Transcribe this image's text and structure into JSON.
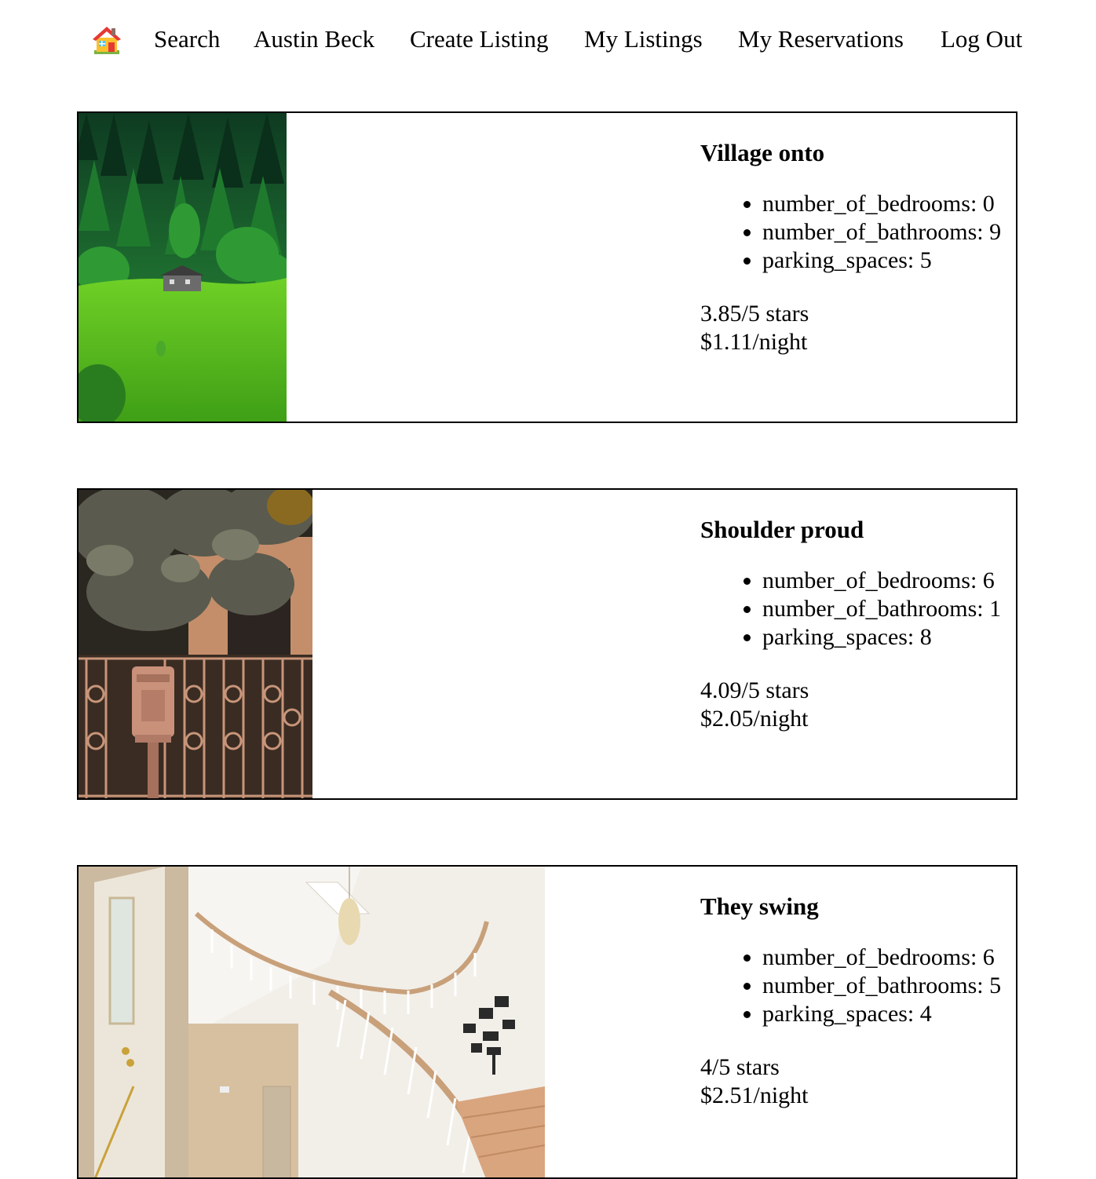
{
  "nav": {
    "home_icon": "house-icon",
    "items": [
      {
        "label": "Search"
      },
      {
        "label": "Austin Beck"
      },
      {
        "label": "Create Listing"
      },
      {
        "label": "My Listings"
      },
      {
        "label": "My Reservations"
      },
      {
        "label": "Log Out"
      }
    ]
  },
  "listings": [
    {
      "title": "Village onto",
      "image": "forest hillside with small cabin",
      "attributes": [
        "number_of_bedrooms: 0",
        "number_of_bathrooms: 9",
        "parking_spaces: 5"
      ],
      "rating": "3.85/5 stars",
      "price": "$1.11/night"
    },
    {
      "title": "Shoulder proud",
      "image": "ornate gate with mailbox under tree",
      "attributes": [
        "number_of_bedrooms: 6",
        "number_of_bathrooms: 1",
        "parking_spaces: 8"
      ],
      "rating": "4.09/5 stars",
      "price": "$2.05/night"
    },
    {
      "title": "They swing",
      "image": "bright foyer with curved staircase",
      "attributes": [
        "number_of_bedrooms: 6",
        "number_of_bathrooms: 5",
        "parking_spaces: 4"
      ],
      "rating": "4/5 stars",
      "price": "$2.51/night"
    }
  ],
  "colors": {
    "text": "#000000",
    "border": "#000000",
    "background": "#ffffff"
  }
}
